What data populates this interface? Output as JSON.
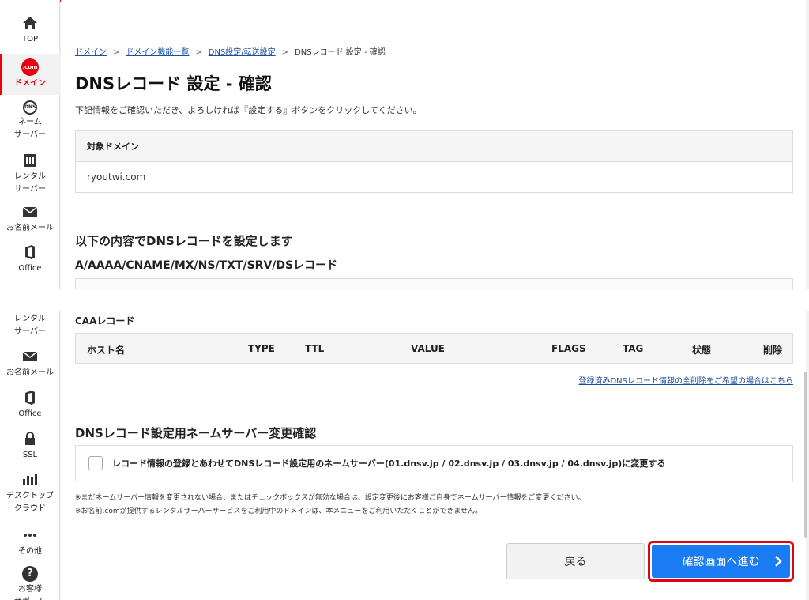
{
  "sidebar": {
    "items": [
      {
        "label": "TOP",
        "icon": "home-icon"
      },
      {
        "label": "ドメイン",
        "icon": "dotcom-icon",
        "badge": ".com"
      },
      {
        "label": "ネーム\nサーバー",
        "icon": "dns-icon",
        "badge": "DNS"
      },
      {
        "label": "レンタル\nサーバー",
        "icon": "server-icon"
      },
      {
        "label": "お名前メール",
        "icon": "mail-icon"
      },
      {
        "label": "Office",
        "icon": "office-icon"
      },
      {
        "label": "レンタル\nサーバー",
        "icon": "server-icon"
      },
      {
        "label": "お名前メール",
        "icon": "mail-icon"
      },
      {
        "label": "Office",
        "icon": "office-icon"
      },
      {
        "label": "SSL",
        "icon": "lock-icon"
      },
      {
        "label": "デスクトップ\nクラウド",
        "icon": "cloud-icon"
      },
      {
        "label": "その他",
        "icon": "more-icon"
      },
      {
        "label": "お客様\nサポート",
        "icon": "help-icon"
      }
    ],
    "accent": "#e60012"
  },
  "breadcrumb": {
    "items": [
      "ドメイン",
      "ドメイン機能一覧",
      "DNS設定/転送設定"
    ],
    "current": "DNSレコード 設定 - 確認"
  },
  "page": {
    "title": "DNSレコード 設定 - 確認",
    "description": "下記情報をご確認いただき、よろしければ『設定する』ボタンをクリックしてください。"
  },
  "domain_box": {
    "header": "対象ドメイン",
    "value": "ryoutwi.com"
  },
  "records": {
    "heading": "以下の内容でDNSレコードを設定します",
    "subheading": "A/AAAA/CNAME/MX/NS/TXT/SRV/DSレコード",
    "caa_heading": "CAAレコード",
    "caa_columns": [
      "ホスト名",
      "TYPE",
      "TTL",
      "VALUE",
      "FLAGS",
      "TAG",
      "状態",
      "削除"
    ],
    "delete_all_link": "登録済みDNSレコード情報の全削除をご希望の場合はこちら"
  },
  "nameserver": {
    "heading": "DNSレコード設定用ネームサーバー変更確認",
    "checkbox_label": "レコード情報の登録とあわせてDNSレコード設定用のネームサーバー(01.dnsv.jp / 02.dnsv.jp / 03.dnsv.jp / 04.dnsv.jp)に変更する",
    "checked": false,
    "notes": [
      "※まだネームサーバー情報を変更されない場合、またはチェックボックスが無効な場合は、設定変更後にお客様ご自身でネームサーバー情報をご変更ください。",
      "※お名前.comが提供するレンタルサーバーサービスをご利用中のドメインは、本メニューをご利用いただくことができません。"
    ]
  },
  "buttons": {
    "back": "戻る",
    "next": "確認画面へ進む",
    "next_color": "#1a7cf2",
    "highlight_color": "#e3000f"
  }
}
